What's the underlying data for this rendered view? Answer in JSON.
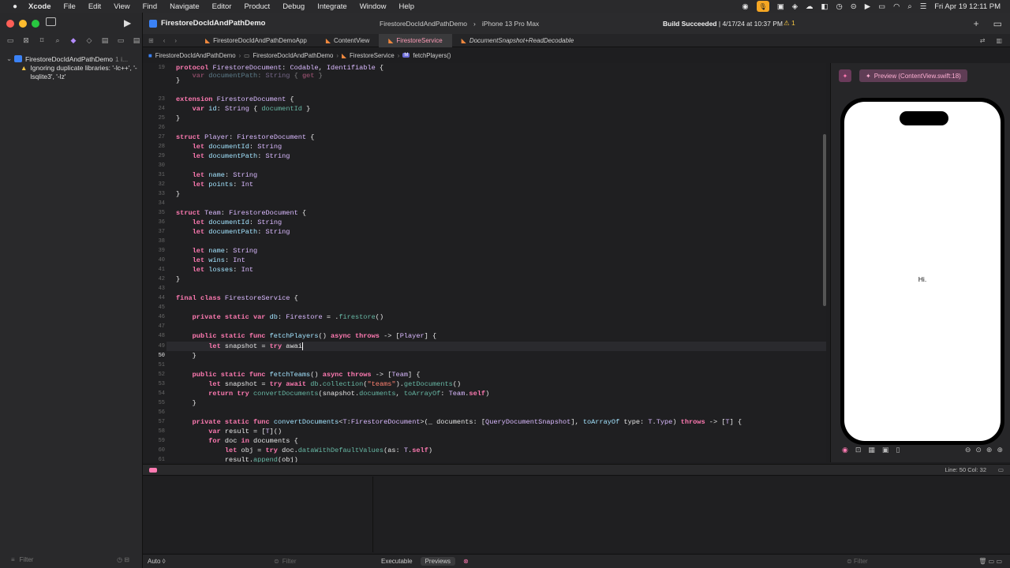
{
  "menubar": {
    "apple": "",
    "items": [
      "Xcode",
      "File",
      "Edit",
      "View",
      "Find",
      "Navigate",
      "Editor",
      "Product",
      "Debug",
      "Integrate",
      "Window",
      "Help"
    ],
    "clock": "Fri Apr 19  12:11 PM"
  },
  "toolbar": {
    "project": "FirestoreDocIdAndPathDemo",
    "scheme": "FirestoreDocIdAndPathDemo",
    "scheme_sep": "›",
    "device": "iPhone 13 Pro Max",
    "build_status": "Build Succeeded",
    "build_time": "4/17/24 at 10:37 PM",
    "warnings": "⚠ 1"
  },
  "navigator": {
    "project_row": "FirestoreDocIdAndPathDemo",
    "project_count": "1 i...",
    "warning_text": "Ignoring duplicate libraries: '-lc++', '-lsqlite3', '-lz'",
    "filter_placeholder": "Filter"
  },
  "tabs": [
    {
      "label": "FirestoreDocIdAndPathDemoApp"
    },
    {
      "label": "ContentView"
    },
    {
      "label": "FirestoreService"
    },
    {
      "label": "DocumentSnapshot+ReadDecodable"
    }
  ],
  "breadcrumb": {
    "items": [
      "FirestoreDocIdAndPathDemo",
      "FirestoreDocIdAndPathDemo",
      "FirestoreService",
      "fetchPlayers()"
    ],
    "sep": "›",
    "method_badge": "M"
  },
  "code": {
    "line_numbers": [
      "19",
      "20",
      "21",
      "22",
      "23",
      "24",
      "25",
      "26",
      "27",
      "28",
      "29",
      "30",
      "31",
      "32",
      "33",
      "34",
      "35",
      "36",
      "37",
      "38",
      "39",
      "40",
      "41",
      "42",
      "43",
      "44",
      "45",
      "46",
      "47",
      "48",
      "49",
      "50",
      "51",
      "52",
      "53",
      "54",
      "55",
      "56",
      "57",
      "58",
      "59",
      "60",
      "61",
      "62"
    ]
  },
  "status": {
    "cursor_position": "Line: 50  Col: 32"
  },
  "preview": {
    "label": "Preview (ContentView.swift:18)",
    "screen_text": "Hi."
  },
  "bottom": {
    "auto": "Auto ◊",
    "filter_placeholder": "Filter",
    "seg_executable": "Executable",
    "seg_previews": "Previews",
    "filter2_placeholder": "Filter"
  },
  "colors": {
    "accent_pink": "#ff7ab2",
    "type_purple": "#dabaff",
    "warning_yellow": "#f4c542"
  }
}
